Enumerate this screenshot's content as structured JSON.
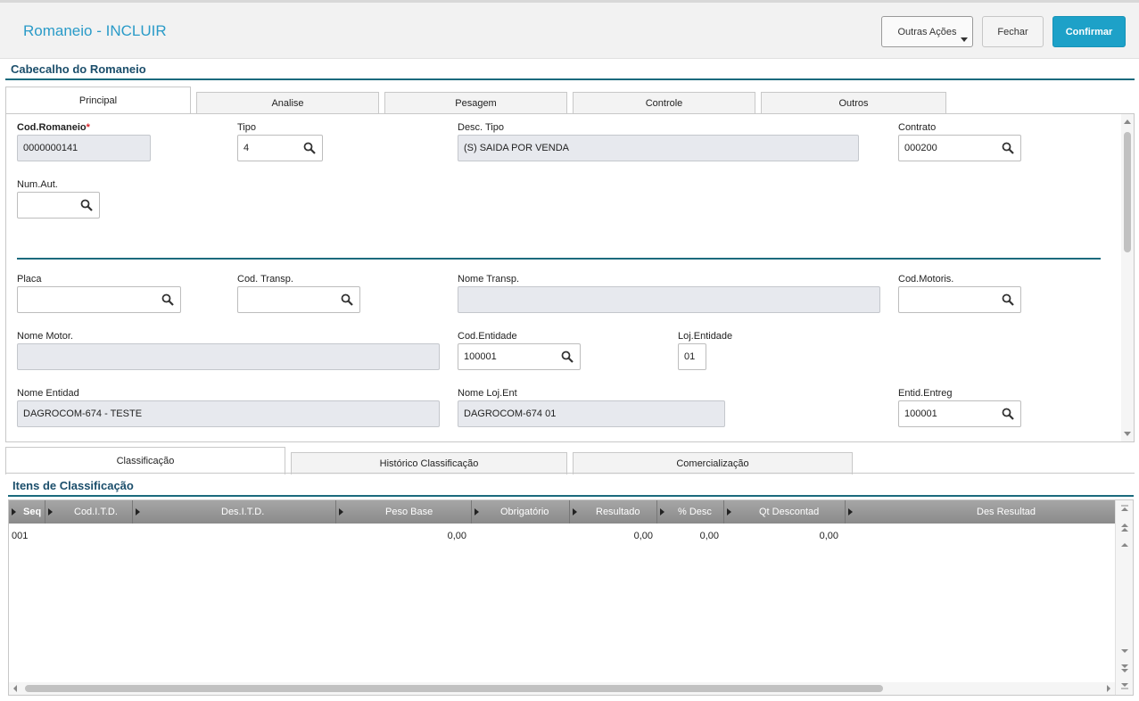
{
  "header": {
    "title": "Romaneio - INCLUIR",
    "outras_acoes": "Outras Ações",
    "fechar": "Fechar",
    "confirmar": "Confirmar"
  },
  "section_header": "Cabecalho do Romaneio",
  "tabs": [
    "Principal",
    "Analise",
    "Pesagem",
    "Controle",
    "Outros"
  ],
  "form": {
    "cod_romaneio": {
      "label": "Cod.Romaneio",
      "required_mark": "*",
      "value": "0000000141"
    },
    "tipo": {
      "label": "Tipo",
      "value": "4"
    },
    "desc_tipo": {
      "label": "Desc. Tipo",
      "value": "(S) SAIDA POR VENDA"
    },
    "contrato": {
      "label": "Contrato",
      "value": "000200"
    },
    "num_aut": {
      "label": "Num.Aut.",
      "value": ""
    },
    "placa": {
      "label": "Placa",
      "value": ""
    },
    "cod_transp": {
      "label": "Cod. Transp.",
      "value": ""
    },
    "nome_transp": {
      "label": "Nome Transp.",
      "value": ""
    },
    "cod_motoris": {
      "label": "Cod.Motoris.",
      "value": ""
    },
    "nome_motor": {
      "label": "Nome Motor.",
      "value": ""
    },
    "cod_entidade": {
      "label": "Cod.Entidade",
      "value": "100001"
    },
    "loj_entidade": {
      "label": "Loj.Entidade",
      "value": "01"
    },
    "nome_entidad": {
      "label": "Nome Entidad",
      "value": "DAGROCOM-674 - TESTE"
    },
    "nome_loj_ent": {
      "label": "Nome Loj.Ent",
      "value": "DAGROCOM-674 01"
    },
    "entid_entreg": {
      "label": "Entid.Entreg",
      "value": "100001"
    }
  },
  "bottom_tabs": [
    "Classificação",
    "Histórico Classificação",
    "Comercialização"
  ],
  "items_section": "Itens de Classificação",
  "grid": {
    "columns": [
      "Seq",
      "Cod.I.T.D.",
      "Des.I.T.D.",
      "Peso Base",
      "Obrigatório",
      "Resultado",
      "% Desc",
      "Qt Descontad",
      "Des Resultad"
    ],
    "rows": [
      {
        "seq": "001",
        "cod_itd": "",
        "des_itd": "",
        "peso_base": "0,00",
        "obrigatorio": "",
        "resultado": "0,00",
        "pct_desc": "0,00",
        "qt_descontad": "0,00",
        "des_resultad": ""
      }
    ]
  },
  "colors": {
    "accent": "#1da1c8",
    "title": "#2a9bc8",
    "section": "#1b4e6b",
    "required": "#d9262c"
  }
}
